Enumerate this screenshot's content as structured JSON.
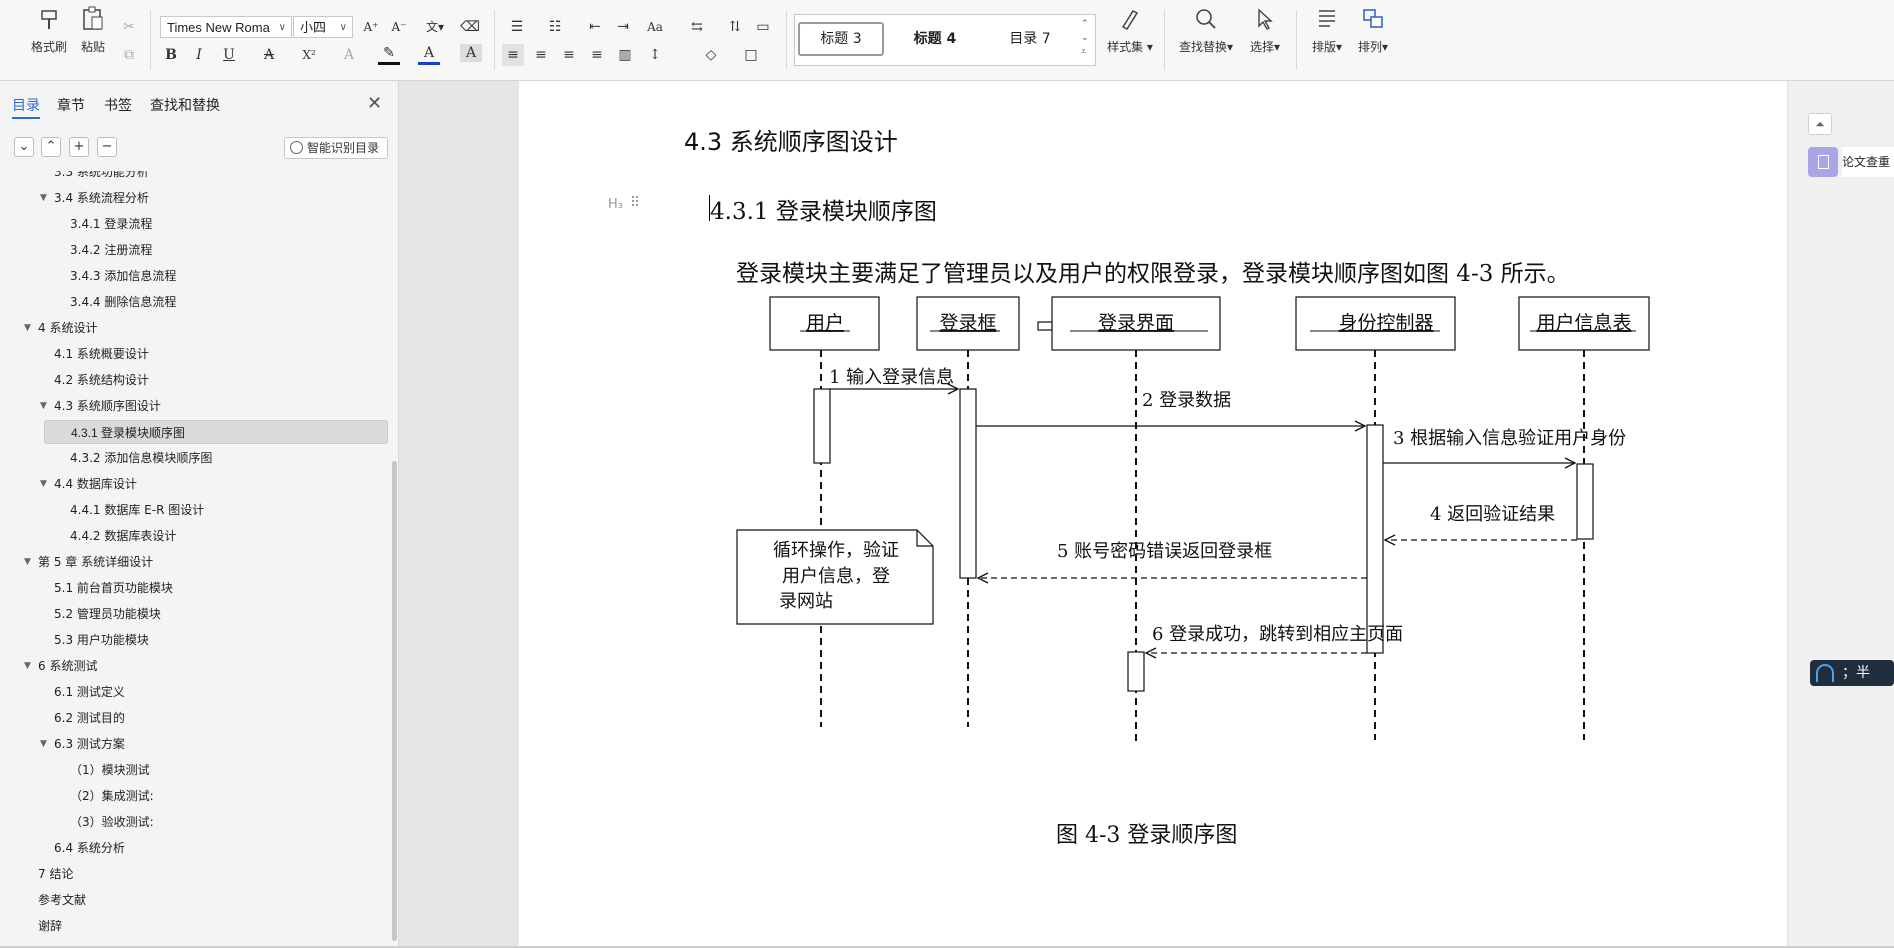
{
  "ribbon": {
    "format_painter": "格式刷",
    "paste": "粘贴",
    "font_name": "Times New Roma",
    "font_size": "小四",
    "styles": [
      "标题 3",
      "标题 4",
      "目录 7"
    ],
    "style_set": "样式集",
    "find_replace": "查找替换",
    "select": "选择",
    "layout": "排版",
    "arrange": "排列"
  },
  "nav": {
    "tabs": [
      "目录",
      "章节",
      "书签",
      "查找和替换"
    ],
    "ai_toc_button": "智能识别目录",
    "toc": [
      {
        "text": "3.3  系统功能分析",
        "level": 2,
        "expand": false
      },
      {
        "text": "3.4 系统流程分析",
        "level": 2,
        "expand": true
      },
      {
        "text": "3.4.1 登录流程",
        "level": 3,
        "expand": false
      },
      {
        "text": "3.4.2 注册流程",
        "level": 3,
        "expand": false
      },
      {
        "text": "3.4.3 添加信息流程",
        "level": 3,
        "expand": false
      },
      {
        "text": "3.4.4 删除信息流程",
        "level": 3,
        "expand": false
      },
      {
        "text": "4   系统设计",
        "level": 1,
        "expand": true
      },
      {
        "text": "4.1 系统概要设计",
        "level": 2,
        "expand": false
      },
      {
        "text": "4.2 系统结构设计",
        "level": 2,
        "expand": false
      },
      {
        "text": "4.3 系统顺序图设计",
        "level": 2,
        "expand": true
      },
      {
        "text": "4.3.1 登录模块顺序图",
        "level": 3,
        "expand": false,
        "selected": true
      },
      {
        "text": "4.3.2 添加信息模块顺序图",
        "level": 3,
        "expand": false
      },
      {
        "text": "4.4 数据库设计",
        "level": 2,
        "expand": true
      },
      {
        "text": "4.4.1 数据库 E-R 图设计",
        "level": 3,
        "expand": false
      },
      {
        "text": "4.4.2 数据库表设计",
        "level": 3,
        "expand": false
      },
      {
        "text": "第 5 章  系统详细设计",
        "level": 1,
        "expand": true
      },
      {
        "text": "5.1 前台首页功能模块",
        "level": 2,
        "expand": false
      },
      {
        "text": "5.2 管理员功能模块",
        "level": 2,
        "expand": false
      },
      {
        "text": "5.3 用户功能模块",
        "level": 2,
        "expand": false
      },
      {
        "text": "6   系统测试",
        "level": 1,
        "expand": true
      },
      {
        "text": "6.1  测试定义",
        "level": 2,
        "expand": false
      },
      {
        "text": "6.2  测试目的",
        "level": 2,
        "expand": false
      },
      {
        "text": "6.3 测试方案",
        "level": 2,
        "expand": true
      },
      {
        "text": "（1）模块测试",
        "level": 3,
        "expand": false
      },
      {
        "text": "（2）集成测试:",
        "level": 3,
        "expand": false
      },
      {
        "text": "（3）验收测试:",
        "level": 3,
        "expand": false
      },
      {
        "text": "6.4 系统分析",
        "level": 2,
        "expand": false
      },
      {
        "text": "7  结论",
        "level": 1,
        "expand": false
      },
      {
        "text": "参考文献",
        "level": 1,
        "expand": false
      },
      {
        "text": "谢辞",
        "level": 1,
        "expand": false
      }
    ]
  },
  "doc": {
    "section_heading": "4.3 系统顺序图设计",
    "subsection_heading": "4.3.1 登录模块顺序图",
    "paragraph": "登录模块主要满足了管理员以及用户的权限登录，登录模块顺序图如图 4-3 所示。",
    "caption": "图 4-3  登录顺序图"
  },
  "diagram": {
    "lifelines": [
      "用户",
      "登录框",
      "登录界面",
      "身份控制器",
      "用户信息表"
    ],
    "messages": [
      "1 输入登录信息",
      "2 登录数据",
      "3 根据输入信息验证用户身份",
      "4 返回验证结果",
      "5 账号密码错误返回登录框",
      "6 登录成功，跳转到相应主页面"
    ],
    "note_lines": [
      "循环操作，验证",
      "用户信息，登",
      "录网站"
    ]
  },
  "right_panel": {
    "paper_check": "论文查重",
    "ime_text": "；半"
  }
}
